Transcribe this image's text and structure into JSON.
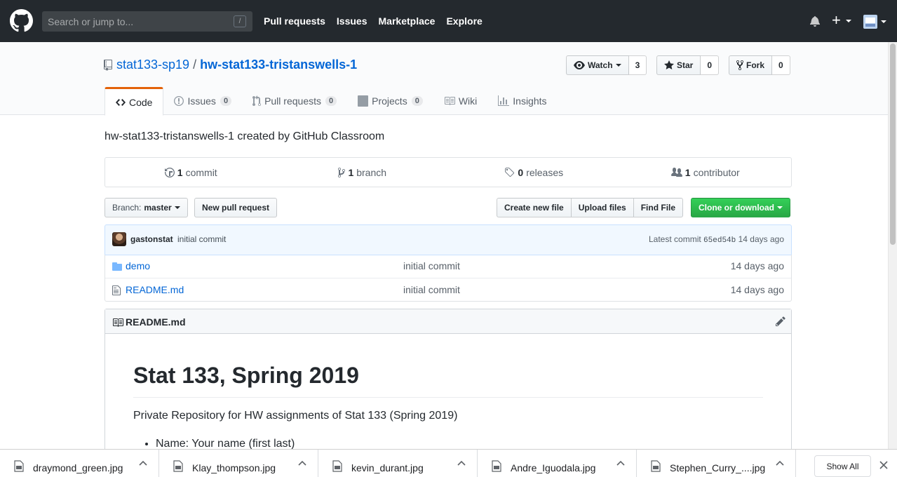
{
  "header": {
    "search_placeholder": "Search or jump to...",
    "search_shortcut": "/",
    "nav": [
      "Pull requests",
      "Issues",
      "Marketplace",
      "Explore"
    ]
  },
  "repo": {
    "owner": "stat133-sp19",
    "separator": "/",
    "name": "hw-stat133-tristanswells-1",
    "watch_label": "Watch",
    "watch_count": "3",
    "star_label": "Star",
    "star_count": "0",
    "fork_label": "Fork",
    "fork_count": "0"
  },
  "tabs": [
    {
      "label": "Code",
      "counter": null,
      "icon": "code-icon"
    },
    {
      "label": "Issues",
      "counter": "0",
      "icon": "issue-icon"
    },
    {
      "label": "Pull requests",
      "counter": "0",
      "icon": "pull-request-icon"
    },
    {
      "label": "Projects",
      "counter": "0",
      "icon": "project-icon"
    },
    {
      "label": "Wiki",
      "counter": null,
      "icon": "book-icon"
    },
    {
      "label": "Insights",
      "counter": null,
      "icon": "graph-icon"
    }
  ],
  "description": "hw-stat133-tristanswells-1 created by GitHub Classroom",
  "numbers": [
    {
      "value": "1",
      "label": "commit",
      "icon": "history-icon"
    },
    {
      "value": "1",
      "label": "branch",
      "icon": "branch-icon"
    },
    {
      "value": "0",
      "label": "releases",
      "icon": "tag-icon"
    },
    {
      "value": "1",
      "label": "contributor",
      "icon": "people-icon"
    }
  ],
  "toolbar": {
    "branch_prefix": "Branch:",
    "branch_name": "master",
    "new_pr": "New pull request",
    "create_file": "Create new file",
    "upload_files": "Upload files",
    "find_file": "Find File",
    "clone": "Clone or download"
  },
  "latest_commit": {
    "author": "gastonstat",
    "message": "initial commit",
    "label": "Latest commit",
    "sha": "65ed54b",
    "age": "14 days ago"
  },
  "files": [
    {
      "name": "demo",
      "type": "directory",
      "message": "initial commit",
      "age": "14 days ago"
    },
    {
      "name": "README.md",
      "type": "file",
      "message": "initial commit",
      "age": "14 days ago"
    }
  ],
  "readme": {
    "title": "README.md",
    "h1": "Stat 133, Spring 2019",
    "paragraph": "Private Repository for HW assignments of Stat 133 (Spring 2019)",
    "bullet": "Name: Your name (first last)"
  },
  "downloads": {
    "items": [
      "draymond_green.jpg",
      "Klay_thompson.jpg",
      "kevin_durant.jpg",
      "Andre_Iguodala.jpg",
      "Stephen_Curry_....jpg"
    ],
    "show_all": "Show All"
  },
  "colors": {
    "header_bg": "#24292e",
    "link": "#0366d6",
    "tab_accent": "#e36209",
    "clone_green": "#28a745"
  }
}
